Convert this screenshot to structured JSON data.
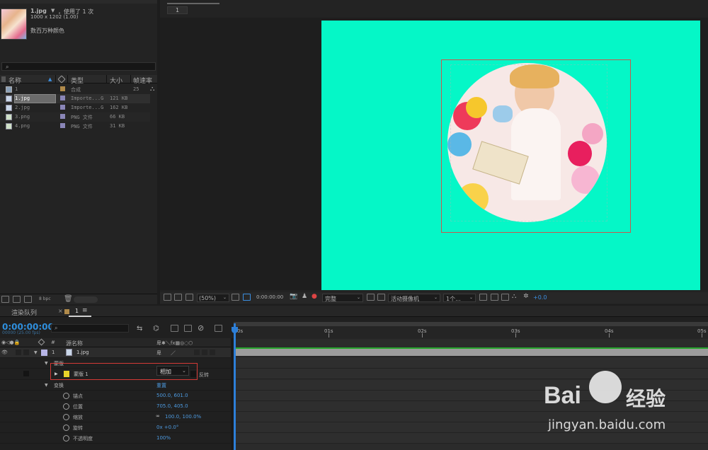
{
  "project": {
    "asset_name": "1.jpg",
    "usage": "，使用了 1 次",
    "dimensions": "1000 x 1202 (1.00)",
    "colors": "数百万种颜色",
    "search_icon": "search-icon",
    "columns": [
      "名称",
      "类型",
      "大小",
      "帧速率"
    ],
    "rows": [
      {
        "name": "1",
        "type": "合成",
        "size": "",
        "fps": "25",
        "swatch": "#b08a4a",
        "kind": "comp"
      },
      {
        "name": "1.jpg",
        "type": "Importe...G",
        "size": "121 KB",
        "fps": "",
        "swatch": "#8a86b8",
        "kind": "file",
        "selected": true
      },
      {
        "name": "2.jpg",
        "type": "Importe...G",
        "size": "162 KB",
        "fps": "",
        "swatch": "#8a86b8",
        "kind": "file"
      },
      {
        "name": "3.png",
        "type": "PNG 文件",
        "size": "66 KB",
        "fps": "",
        "swatch": "#8a86b8",
        "kind": "png"
      },
      {
        "name": "4.png",
        "type": "PNG 文件",
        "size": "31 KB",
        "fps": "",
        "swatch": "#8a86b8",
        "kind": "png"
      }
    ],
    "bpc": "8 bpc"
  },
  "composition": {
    "tab_name": "1",
    "background_color": "#05f7c7",
    "zoom": "(50%)",
    "timecode": "0:00:00:00",
    "resolution": "完整",
    "camera": "活动摄像机",
    "views": "1个...",
    "exposure": "+0.0"
  },
  "timeline": {
    "render_queue_tab": "渲染队列",
    "comp_tab": "1",
    "timecode": "0:00:00:00",
    "fps_label": "00000 (25.00 fps)",
    "column_source": "源名称",
    "ruler_ticks": [
      "0s",
      "01s",
      "02s",
      "03s",
      "04s",
      "05s"
    ],
    "layer": {
      "number": "1",
      "name": "1.jpg",
      "color": "#b7b5e6"
    },
    "masks_group": "蒙版",
    "mask": {
      "name": "蒙版 1",
      "mode": "相加",
      "inverted_label": "反转",
      "color": "#e8d22a"
    },
    "transform_group": "变换",
    "reset_label": "重置",
    "properties": [
      {
        "name": "锚点",
        "value": "500.0, 601.0"
      },
      {
        "name": "位置",
        "value": "705.0, 405.0"
      },
      {
        "name": "缩放",
        "value": "100.0, 100.0%"
      },
      {
        "name": "旋转",
        "value": "0x +0.0°"
      },
      {
        "name": "不透明度",
        "value": "100%"
      }
    ]
  },
  "watermark": {
    "brand": "Bai",
    "brand2": "经验",
    "url": "jingyan.baidu.com"
  }
}
